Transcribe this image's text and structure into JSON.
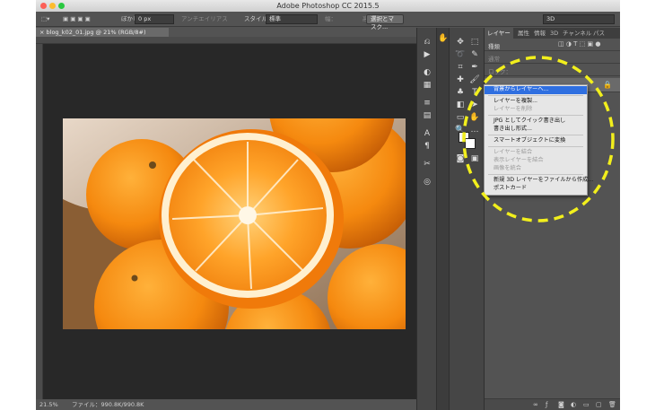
{
  "app": {
    "title": "Adobe Photoshop CC 2015.5"
  },
  "options": {
    "feather_label": "ぼかし：",
    "feather_value": "0 px",
    "antialias_label": "アンチエイリアス",
    "style_label": "スタイル：",
    "style_value": "標準",
    "width_label": "幅：",
    "height_label": "高さ：",
    "select_mask_button": "選択とマスク...",
    "workspace_value": "3D"
  },
  "document": {
    "tab_label": "blog_k02_01.jpg @ 21% (RGB/8#)",
    "zoom": "21.5%",
    "file_info": "ファイル：990.8K/990.8K"
  },
  "layers_panel": {
    "tabs": [
      "レイヤー",
      "属性",
      "情報",
      "3D",
      "チャンネル",
      "パス"
    ],
    "active_tab": 0,
    "filter_label": "種類",
    "mode_label": "通常",
    "lock_label": "ロック："
  },
  "context_menu": {
    "items": [
      {
        "label": "背景からレイヤーへ...",
        "state": "selected"
      },
      {
        "label": "レイヤーを複製...",
        "state": "enabled"
      },
      {
        "label": "レイヤーを削除",
        "state": "disabled"
      },
      {
        "label": "JPG としてクイック書き出し",
        "state": "enabled"
      },
      {
        "label": "書き出し形式...",
        "state": "enabled"
      },
      {
        "label": "スマートオブジェクトに変換",
        "state": "enabled"
      },
      {
        "label": "レイヤーを結合",
        "state": "disabled"
      },
      {
        "label": "表示レイヤーを結合",
        "state": "disabled"
      },
      {
        "label": "画像を統合",
        "state": "disabled"
      },
      {
        "label": "新規 3D レイヤーをファイルから作成...",
        "state": "enabled"
      },
      {
        "label": "ポストカード",
        "state": "enabled"
      }
    ]
  },
  "colors": {
    "selected_menu": "#2f6fe0",
    "callout": "#f2ef1c",
    "ui_panel": "#535353",
    "canvas_bg": "#282828"
  },
  "icons": [
    "close-icon",
    "minimize-icon",
    "maximize-icon",
    "marquee-tool-icon",
    "move-tool-icon",
    "lasso-tool-icon",
    "brush-tool-icon",
    "type-tool-icon",
    "zoom-tool-icon",
    "hand-tool-icon",
    "lock-icon",
    "link-icon",
    "fx-icon",
    "mask-icon",
    "new-layer-icon",
    "trash-icon"
  ]
}
